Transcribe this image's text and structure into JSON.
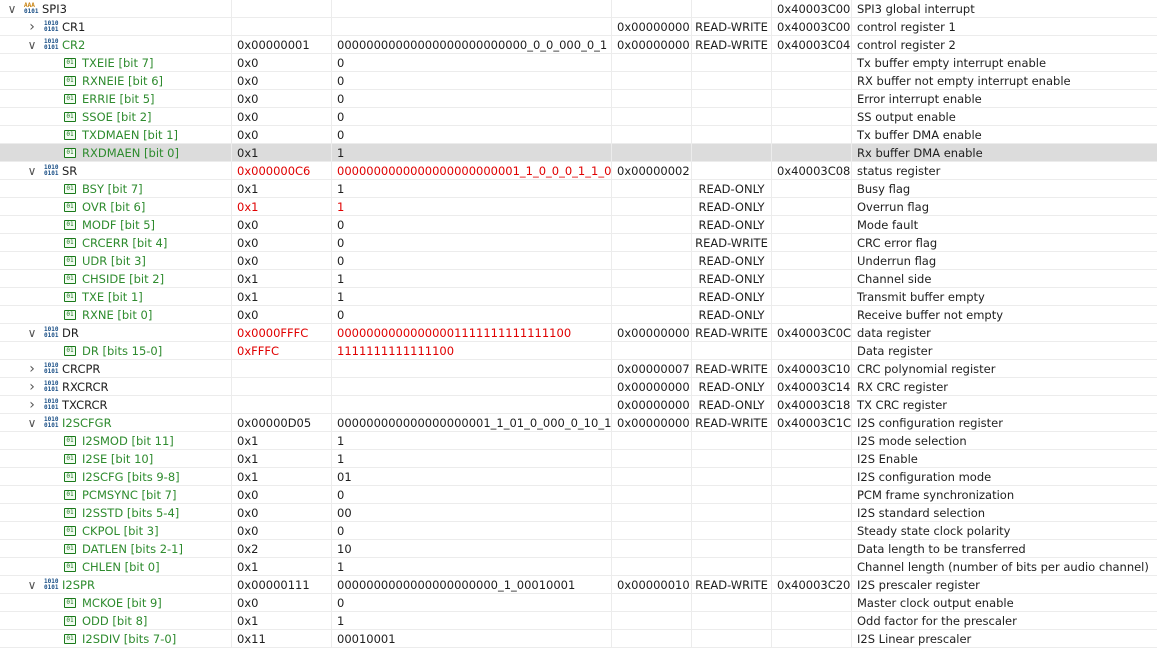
{
  "rows": [
    {
      "type": "group",
      "name": "SPI3",
      "value": "",
      "bits": "",
      "reset": "",
      "access": "",
      "address": "0x40003C00",
      "desc": "SPI3 global interrupt",
      "expanded": true,
      "changed": false
    },
    {
      "type": "reg",
      "name": "CR1",
      "value": "",
      "bits": "",
      "reset": "0x00000000",
      "access": "READ-WRITE",
      "address": "0x40003C00",
      "desc": "control register 1",
      "expanded": false,
      "changed": false
    },
    {
      "type": "reg",
      "name": "CR2",
      "value": "0x00000001",
      "bits": "00000000000000000000000000_0_0_000_0_1",
      "reset": "0x00000000",
      "access": "READ-WRITE",
      "address": "0x40003C04",
      "desc": "control register 2",
      "expanded": true,
      "changed": false,
      "modified": true
    },
    {
      "type": "field",
      "name": "TXEIE [bit 7]",
      "value": "0x0",
      "bits": "0",
      "reset": "",
      "access": "",
      "address": "",
      "desc": "Tx buffer empty interrupt enable",
      "changed": false
    },
    {
      "type": "field",
      "name": "RXNEIE [bit 6]",
      "value": "0x0",
      "bits": "0",
      "reset": "",
      "access": "",
      "address": "",
      "desc": "RX buffer not empty interrupt enable",
      "changed": false
    },
    {
      "type": "field",
      "name": "ERRIE [bit 5]",
      "value": "0x0",
      "bits": "0",
      "reset": "",
      "access": "",
      "address": "",
      "desc": "Error interrupt enable",
      "changed": false
    },
    {
      "type": "field",
      "name": "SSOE [bit 2]",
      "value": "0x0",
      "bits": "0",
      "reset": "",
      "access": "",
      "address": "",
      "desc": "SS output enable",
      "changed": false
    },
    {
      "type": "field",
      "name": "TXDMAEN [bit 1]",
      "value": "0x0",
      "bits": "0",
      "reset": "",
      "access": "",
      "address": "",
      "desc": "Tx buffer DMA enable",
      "changed": false
    },
    {
      "type": "field",
      "name": "RXDMAEN [bit 0]",
      "value": "0x1",
      "bits": "1",
      "reset": "",
      "access": "",
      "address": "",
      "desc": "Rx buffer DMA enable",
      "changed": false,
      "selected": true
    },
    {
      "type": "reg",
      "name": "SR",
      "value": "0x000000C6",
      "bits": "0000000000000000000000001_1_0_0_0_1_1_0",
      "reset": "0x00000002",
      "access": "",
      "address": "0x40003C08",
      "desc": "status register",
      "expanded": true,
      "changed": true,
      "modified": true
    },
    {
      "type": "field",
      "name": "BSY [bit 7]",
      "value": "0x1",
      "bits": "1",
      "reset": "",
      "access": "READ-ONLY",
      "address": "",
      "desc": "Busy flag",
      "changed": false
    },
    {
      "type": "field",
      "name": "OVR [bit 6]",
      "value": "0x1",
      "bits": "1",
      "reset": "",
      "access": "READ-ONLY",
      "address": "",
      "desc": "Overrun flag",
      "changed": true
    },
    {
      "type": "field",
      "name": "MODF [bit 5]",
      "value": "0x0",
      "bits": "0",
      "reset": "",
      "access": "READ-ONLY",
      "address": "",
      "desc": "Mode fault",
      "changed": false
    },
    {
      "type": "field",
      "name": "CRCERR [bit 4]",
      "value": "0x0",
      "bits": "0",
      "reset": "",
      "access": "READ-WRITE",
      "address": "",
      "desc": "CRC error flag",
      "changed": false
    },
    {
      "type": "field",
      "name": "UDR [bit 3]",
      "value": "0x0",
      "bits": "0",
      "reset": "",
      "access": "READ-ONLY",
      "address": "",
      "desc": "Underrun flag",
      "changed": false
    },
    {
      "type": "field",
      "name": "CHSIDE [bit 2]",
      "value": "0x1",
      "bits": "1",
      "reset": "",
      "access": "READ-ONLY",
      "address": "",
      "desc": "Channel side",
      "changed": false
    },
    {
      "type": "field",
      "name": "TXE [bit 1]",
      "value": "0x1",
      "bits": "1",
      "reset": "",
      "access": "READ-ONLY",
      "address": "",
      "desc": "Transmit buffer empty",
      "changed": false
    },
    {
      "type": "field",
      "name": "RXNE [bit 0]",
      "value": "0x0",
      "bits": "0",
      "reset": "",
      "access": "READ-ONLY",
      "address": "",
      "desc": "Receive buffer not empty",
      "changed": false
    },
    {
      "type": "reg",
      "name": "DR",
      "value": "0x0000FFFC",
      "bits": "00000000000000001111111111111100",
      "reset": "0x00000000",
      "access": "READ-WRITE",
      "address": "0x40003C0C",
      "desc": "data register",
      "expanded": true,
      "changed": true,
      "modified": true
    },
    {
      "type": "field",
      "name": "DR [bits 15-0]",
      "value": "0xFFFC",
      "bits": "1111111111111100",
      "reset": "",
      "access": "",
      "address": "",
      "desc": "Data register",
      "changed": true
    },
    {
      "type": "reg",
      "name": "CRCPR",
      "value": "",
      "bits": "",
      "reset": "0x00000007",
      "access": "READ-WRITE",
      "address": "0x40003C10",
      "desc": "CRC polynomial register",
      "expanded": false,
      "changed": false
    },
    {
      "type": "reg",
      "name": "RXCRCR",
      "value": "",
      "bits": "",
      "reset": "0x00000000",
      "access": "READ-ONLY",
      "address": "0x40003C14",
      "desc": "RX CRC register",
      "expanded": false,
      "changed": false
    },
    {
      "type": "reg",
      "name": "TXCRCR",
      "value": "",
      "bits": "",
      "reset": "0x00000000",
      "access": "READ-ONLY",
      "address": "0x40003C18",
      "desc": "TX CRC register",
      "expanded": false,
      "changed": false
    },
    {
      "type": "reg",
      "name": "I2SCFGR",
      "value": "0x00000D05",
      "bits": "000000000000000000001_1_01_0_000_0_10_1",
      "reset": "0x00000000",
      "access": "READ-WRITE",
      "address": "0x40003C1C",
      "desc": "I2S configuration register",
      "expanded": true,
      "changed": false,
      "modified": true
    },
    {
      "type": "field",
      "name": "I2SMOD [bit 11]",
      "value": "0x1",
      "bits": "1",
      "reset": "",
      "access": "",
      "address": "",
      "desc": "I2S mode selection",
      "changed": false
    },
    {
      "type": "field",
      "name": "I2SE [bit 10]",
      "value": "0x1",
      "bits": "1",
      "reset": "",
      "access": "",
      "address": "",
      "desc": "I2S Enable",
      "changed": false
    },
    {
      "type": "field",
      "name": "I2SCFG [bits 9-8]",
      "value": "0x1",
      "bits": "01",
      "reset": "",
      "access": "",
      "address": "",
      "desc": "I2S configuration mode",
      "changed": false
    },
    {
      "type": "field",
      "name": "PCMSYNC [bit 7]",
      "value": "0x0",
      "bits": "0",
      "reset": "",
      "access": "",
      "address": "",
      "desc": "PCM frame synchronization",
      "changed": false
    },
    {
      "type": "field",
      "name": "I2SSTD [bits 5-4]",
      "value": "0x0",
      "bits": "00",
      "reset": "",
      "access": "",
      "address": "",
      "desc": "I2S standard selection",
      "changed": false
    },
    {
      "type": "field",
      "name": "CKPOL [bit 3]",
      "value": "0x0",
      "bits": "0",
      "reset": "",
      "access": "",
      "address": "",
      "desc": "Steady state clock polarity",
      "changed": false
    },
    {
      "type": "field",
      "name": "DATLEN [bits 2-1]",
      "value": "0x2",
      "bits": "10",
      "reset": "",
      "access": "",
      "address": "",
      "desc": "Data length to be transferred",
      "changed": false
    },
    {
      "type": "field",
      "name": "CHLEN [bit 0]",
      "value": "0x1",
      "bits": "1",
      "reset": "",
      "access": "",
      "address": "",
      "desc": "Channel length (number of bits per audio channel)",
      "changed": false
    },
    {
      "type": "reg",
      "name": "I2SPR",
      "value": "0x00000111",
      "bits": "0000000000000000000000_1_00010001",
      "reset": "0x00000010",
      "access": "READ-WRITE",
      "address": "0x40003C20",
      "desc": "I2S prescaler register",
      "expanded": true,
      "changed": false,
      "modified": true
    },
    {
      "type": "field",
      "name": "MCKOE [bit 9]",
      "value": "0x0",
      "bits": "0",
      "reset": "",
      "access": "",
      "address": "",
      "desc": "Master clock output enable",
      "changed": false
    },
    {
      "type": "field",
      "name": "ODD [bit 8]",
      "value": "0x1",
      "bits": "1",
      "reset": "",
      "access": "",
      "address": "",
      "desc": "Odd factor for the prescaler",
      "changed": false
    },
    {
      "type": "field",
      "name": "I2SDIV [bits 7-0]",
      "value": "0x11",
      "bits": "00010001",
      "reset": "",
      "access": "",
      "address": "",
      "desc": "I2S Linear prescaler",
      "changed": false
    }
  ],
  "colors": {
    "changed": "#e00000",
    "field_name": "#2e8b2e",
    "selected_row": "#dcdcdc"
  },
  "icons": {
    "group": "peripheral-group-icon",
    "reg": "register-binary-icon",
    "field": "bitfield-icon",
    "collapsed": "chevron-right-icon",
    "expanded": "chevron-down-icon"
  }
}
